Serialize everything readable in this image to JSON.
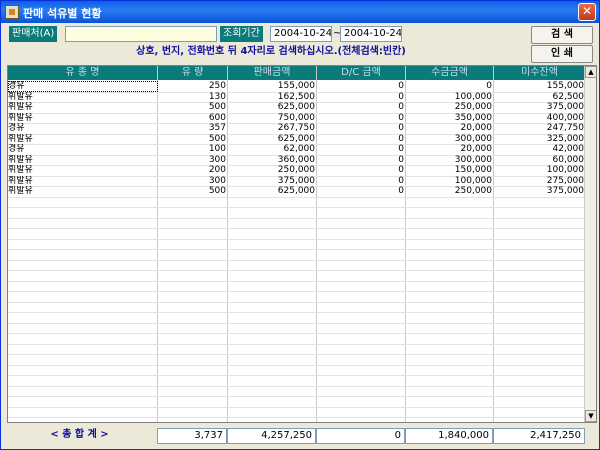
{
  "window": {
    "title": "판매 석유별 현황",
    "close_glyph": "✕"
  },
  "filters": {
    "seller_label": "판매처(A)",
    "seller_value": "",
    "period_label": "조회기간",
    "date_from": "2004-10-24",
    "range_sep": "~",
    "date_to": "2004-10-24"
  },
  "hint": "상호, 번지, 전화번호 뒤 4자리로 검색하십시오.(전체검색:빈칸)",
  "buttons": {
    "search": "검 색",
    "print": "인 쇄"
  },
  "table": {
    "columns": [
      "유 종 명",
      "유 량",
      "판매금액",
      "D/C 금액",
      "수금금액",
      "미수잔액"
    ],
    "rows": [
      [
        "경유",
        "250",
        "155,000",
        "0",
        "0",
        "155,000"
      ],
      [
        "휘발유",
        "130",
        "162,500",
        "0",
        "100,000",
        "62,500"
      ],
      [
        "휘발유",
        "500",
        "625,000",
        "0",
        "250,000",
        "375,000"
      ],
      [
        "휘발유",
        "600",
        "750,000",
        "0",
        "350,000",
        "400,000"
      ],
      [
        "경유",
        "357",
        "267,750",
        "0",
        "20,000",
        "247,750"
      ],
      [
        "휘발유",
        "500",
        "625,000",
        "0",
        "300,000",
        "325,000"
      ],
      [
        "경유",
        "100",
        "62,000",
        "0",
        "20,000",
        "42,000"
      ],
      [
        "휘발유",
        "300",
        "360,000",
        "0",
        "300,000",
        "60,000"
      ],
      [
        "휘발유",
        "200",
        "250,000",
        "0",
        "150,000",
        "100,000"
      ],
      [
        "휘발유",
        "300",
        "375,000",
        "0",
        "100,000",
        "275,000"
      ],
      [
        "휘발유",
        "500",
        "625,000",
        "0",
        "250,000",
        "375,000"
      ]
    ]
  },
  "totals": {
    "label": "< 총   합   계 >",
    "volume": "3,737",
    "sales": "4,257,250",
    "dc": "0",
    "collected": "1,840,000",
    "outstanding": "2,417,250"
  },
  "scroll": {
    "up_glyph": "▲",
    "down_glyph": "▼"
  },
  "colors": {
    "header_bg": "#0b7a7a",
    "title_bar": "#0a5fe6",
    "hint_text": "#1010a0"
  }
}
